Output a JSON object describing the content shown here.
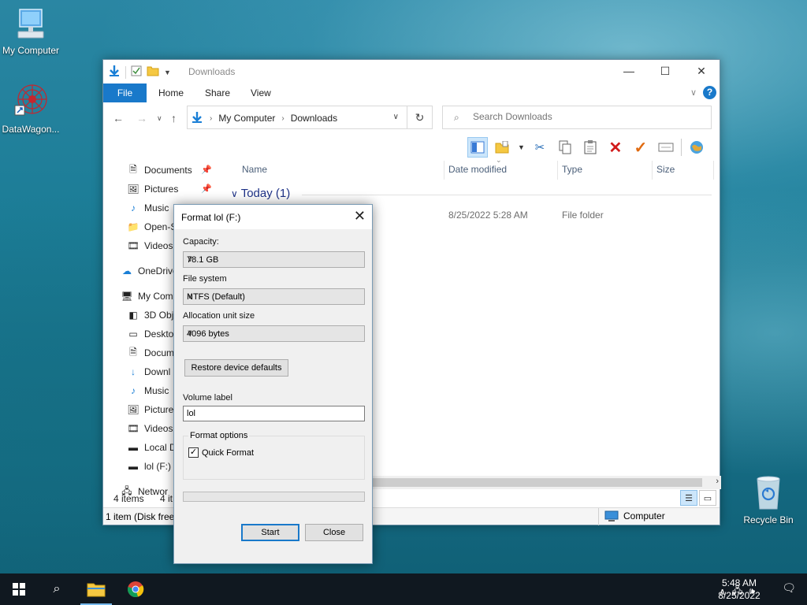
{
  "desktop": {
    "icons": [
      {
        "label": "My Computer",
        "icon": "computer-icon"
      },
      {
        "label": "DataWagon...",
        "icon": "datawagon-icon"
      },
      {
        "label": "Recycle Bin",
        "icon": "recycle-bin-icon"
      }
    ]
  },
  "explorer": {
    "title": "Downloads",
    "ribbon_tabs": [
      "File",
      "Home",
      "Share",
      "View"
    ],
    "breadcrumb": [
      "My Computer",
      "Downloads"
    ],
    "search_placeholder": "Search Downloads",
    "nav_pane": [
      {
        "label": "Documents",
        "icon": "documents-icon",
        "pinned": true
      },
      {
        "label": "Pictures",
        "icon": "pictures-icon",
        "pinned": true
      },
      {
        "label": "Music",
        "icon": "music-icon"
      },
      {
        "label": "Open-S",
        "icon": "folder-icon"
      },
      {
        "label": "Videos",
        "icon": "videos-icon"
      },
      {
        "label": "OneDrive",
        "icon": "onedrive-icon"
      },
      {
        "label": "My Com",
        "icon": "computer-icon"
      },
      {
        "label": "3D Obj",
        "icon": "3d-objects-icon"
      },
      {
        "label": "Desktop",
        "icon": "desktop-icon"
      },
      {
        "label": "Docum",
        "icon": "documents-icon"
      },
      {
        "label": "Downl",
        "icon": "downloads-icon"
      },
      {
        "label": "Music",
        "icon": "music-icon"
      },
      {
        "label": "Picture",
        "icon": "pictures-icon"
      },
      {
        "label": "Videos",
        "icon": "videos-icon"
      },
      {
        "label": "Local D",
        "icon": "drive-icon"
      },
      {
        "label": "lol (F:)",
        "icon": "drive-icon"
      },
      {
        "label": "Networ",
        "icon": "network-icon"
      }
    ],
    "columns": [
      "Name",
      "Date modified",
      "Type",
      "Size"
    ],
    "group_header": "Today (1)",
    "rows": [
      {
        "date_modified": "8/25/2022 5:28 AM",
        "type": "File folder"
      }
    ],
    "status_items": "4 items",
    "status_items_partial": "4 it",
    "status_bottom": "1 item (Disk free",
    "status_location": "Computer"
  },
  "format_dialog": {
    "title": "Format lol (F:)",
    "capacity_label": "Capacity:",
    "capacity_value": "78.1 GB",
    "filesystem_label": "File system",
    "filesystem_value": "NTFS (Default)",
    "allocation_label": "Allocation unit size",
    "allocation_value": "4096 bytes",
    "restore_button": "Restore device defaults",
    "volume_label": "Volume label",
    "volume_value": "lol",
    "format_options_label": "Format options",
    "quick_format_label": "Quick Format",
    "quick_format_checked": true,
    "progress": 0,
    "start_button": "Start",
    "close_button": "Close"
  },
  "taskbar": {
    "time": "5:48 AM",
    "date": "8/25/2022"
  }
}
